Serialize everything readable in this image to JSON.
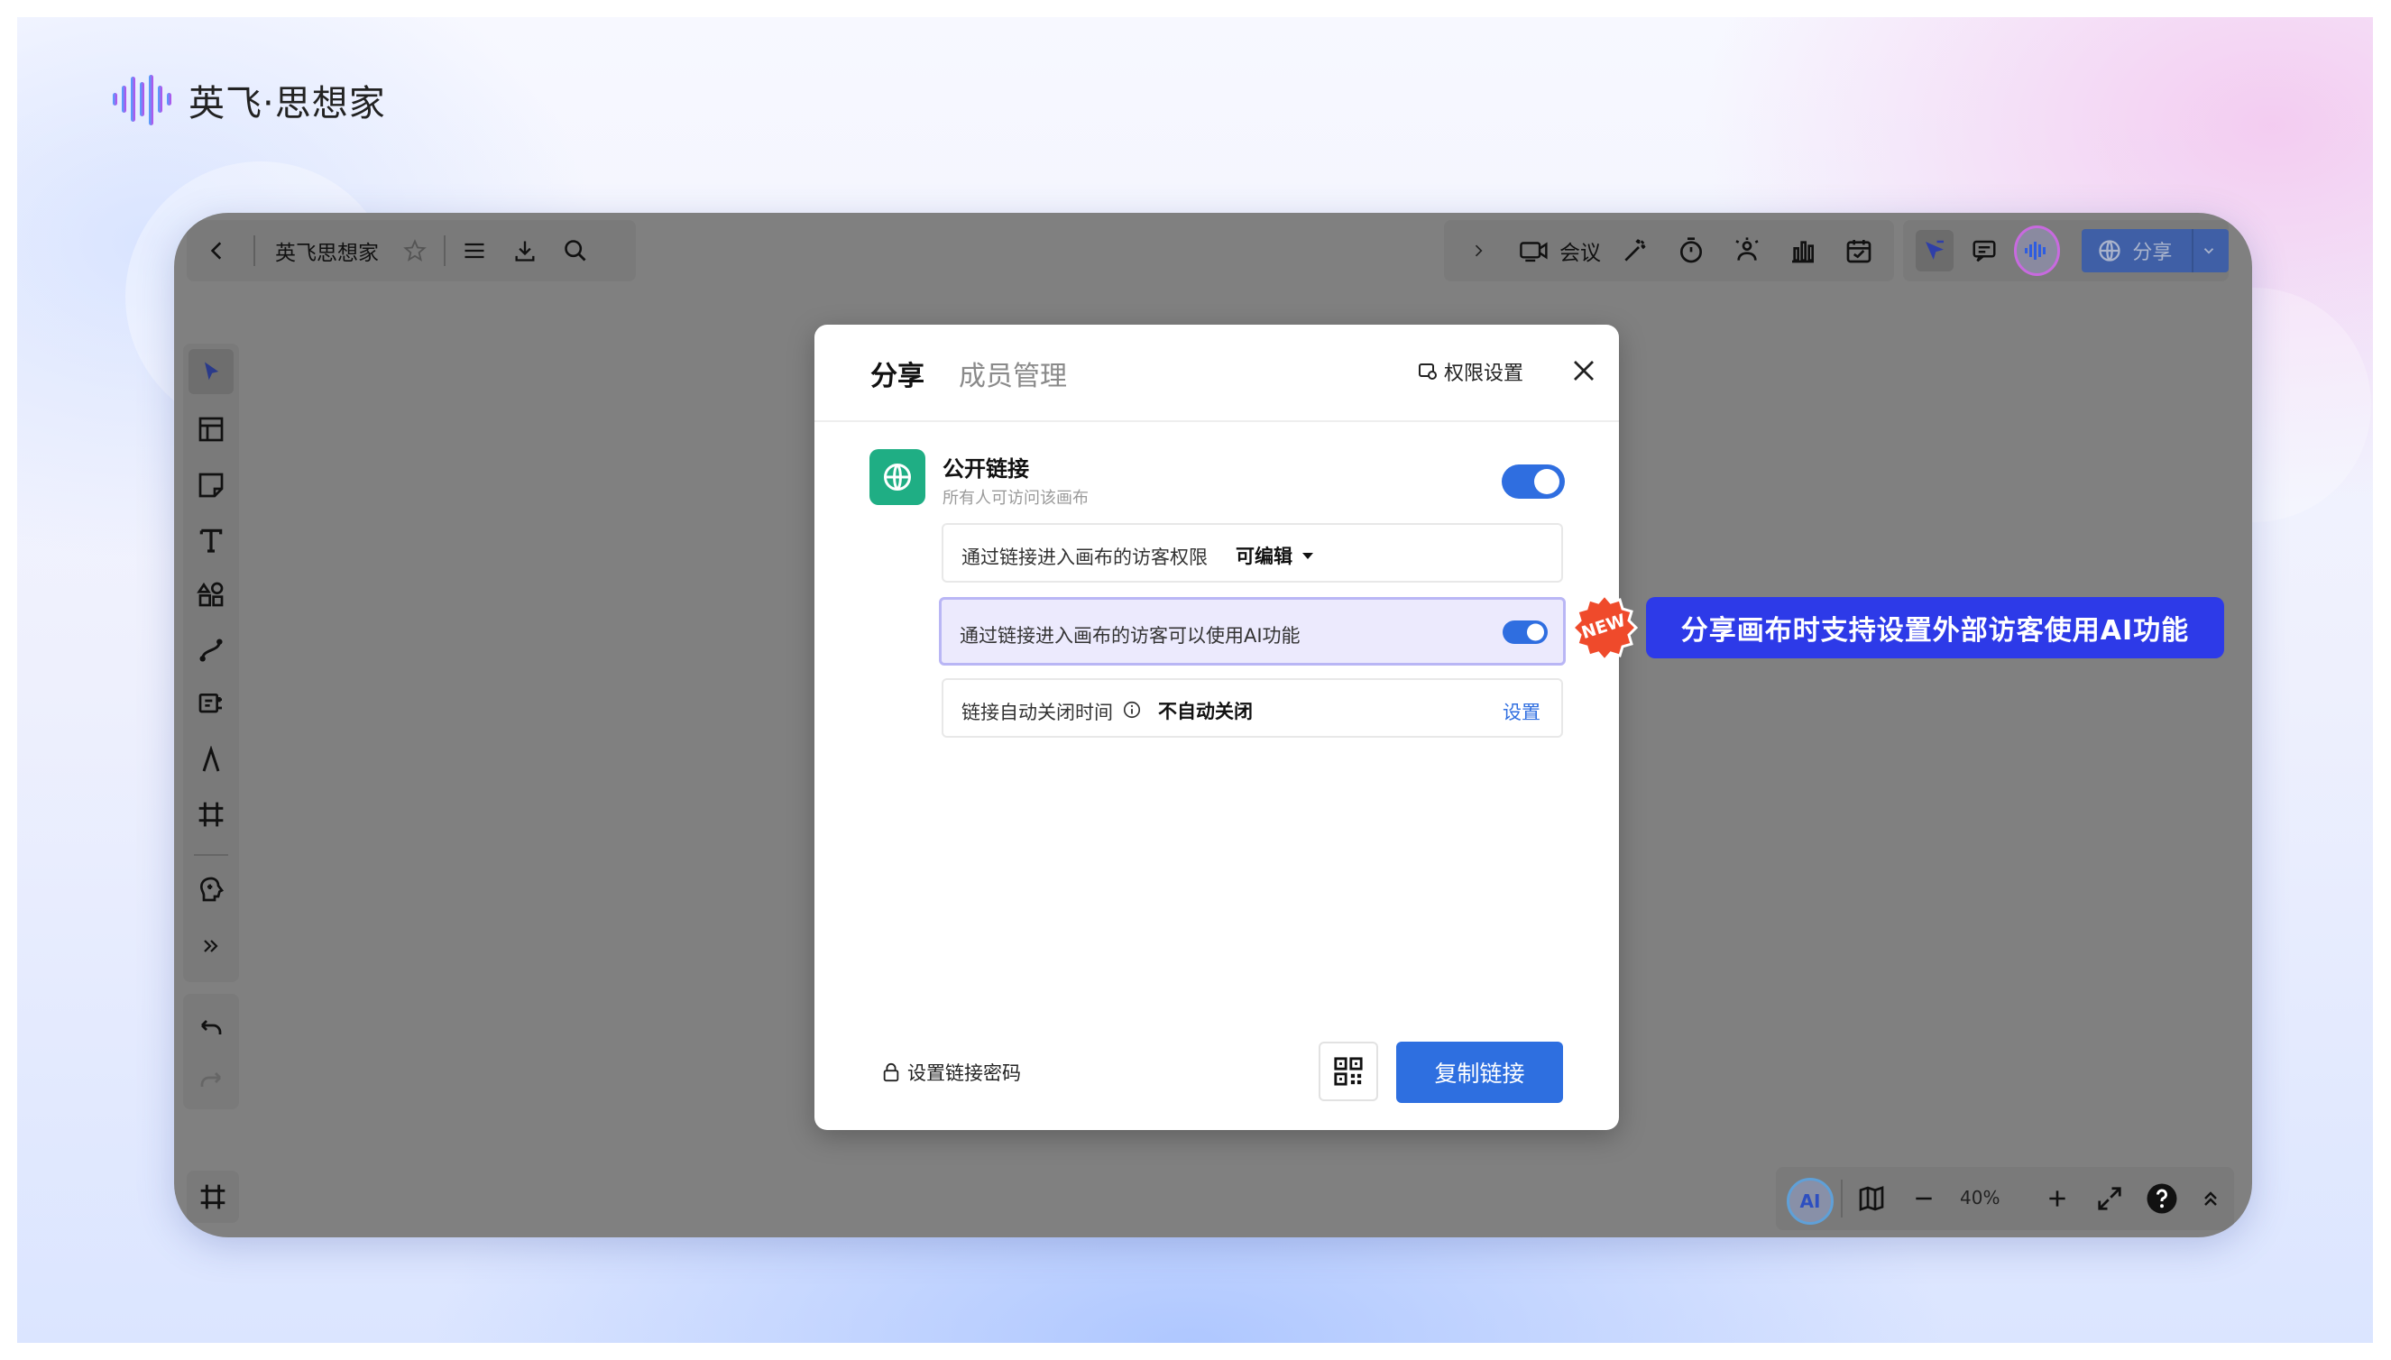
{
  "brand": {
    "name": "英飞·思想家"
  },
  "toolbar": {
    "doc_title": "英飞思想家",
    "meeting_label": "会议",
    "share_label": "分享"
  },
  "dialog": {
    "tab_share": "分享",
    "tab_members": "成员管理",
    "permission_settings": "权限设置",
    "public_link": {
      "title": "公开链接",
      "subtitle": "所有人可访问该画布",
      "enabled": true
    },
    "visitor_permission": {
      "label": "通过链接进入画布的访客权限",
      "value": "可编辑"
    },
    "visitor_ai": {
      "label": "通过链接进入画布的访客可以使用AI功能",
      "enabled": true
    },
    "auto_close": {
      "label": "链接自动关闭时间",
      "value": "不自动关闭",
      "action": "设置"
    },
    "set_password": "设置链接密码",
    "copy_link": "复制链接"
  },
  "badge": {
    "text": "NEW"
  },
  "callout": {
    "text": "分享画布时支持设置外部访客使用AI功能"
  },
  "zoom": {
    "level": "40%"
  },
  "colors": {
    "accent": "#2e6fe0",
    "callout": "#2d3ae8",
    "badge": "#ef4a2b",
    "public_link_icon_bg": "#1fae84"
  },
  "icons": [
    "back-icon",
    "star-icon",
    "menu-icon",
    "download-icon",
    "search-icon",
    "chevron-right-icon",
    "video-icon",
    "magic-wand-icon",
    "timer-icon",
    "vote-icon",
    "chart-icon",
    "calendar-icon",
    "laser-pointer-icon",
    "comment-icon",
    "voice-icon",
    "globe-icon",
    "chevron-down-icon",
    "cursor-icon",
    "layout-icon",
    "sticky-note-icon",
    "text-icon",
    "shapes-icon",
    "connector-icon",
    "mindmap-icon",
    "pen-icon",
    "frame-icon",
    "brain-icon",
    "more-icon",
    "undo-icon",
    "redo-icon",
    "ai-icon",
    "map-icon",
    "zoom-out-icon",
    "zoom-in-icon",
    "fullscreen-icon",
    "help-icon",
    "collapse-icon",
    "close-icon",
    "lock-icon",
    "qr-code-icon",
    "info-icon"
  ]
}
